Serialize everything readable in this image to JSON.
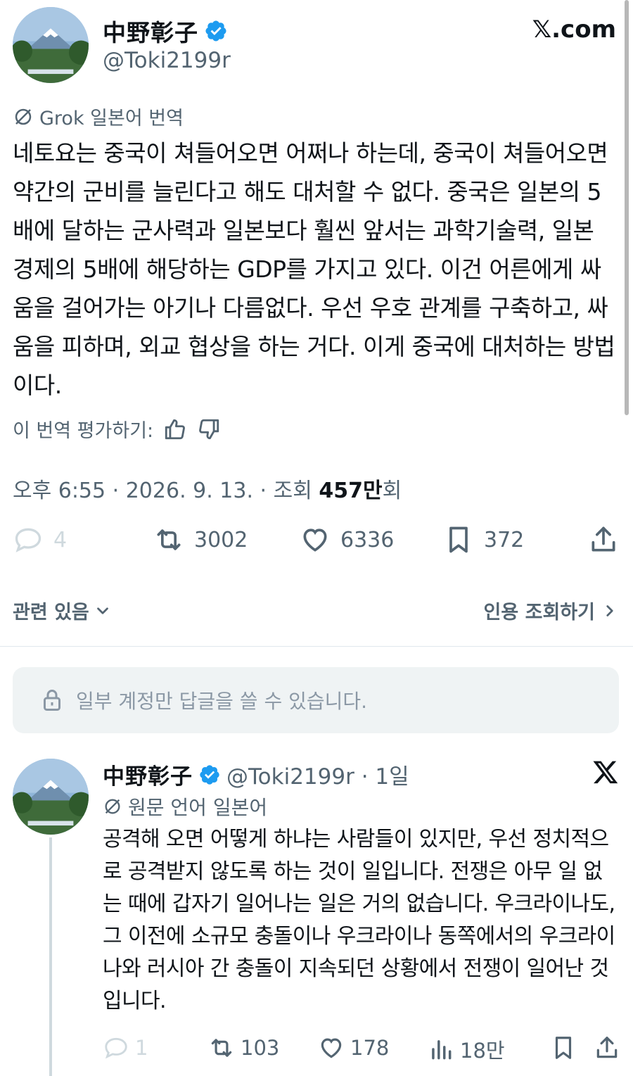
{
  "header": {
    "display_name": "中野彰子",
    "handle": "@Toki2199r",
    "site": "𝕏.com"
  },
  "grok": {
    "label": "Grok 일본어 번역"
  },
  "translation": {
    "text": "네토요는 중국이 쳐들어오면 어쩌나 하는데, 중국이 쳐들어오면 약간의 군비를 늘린다고 해도 대처할 수 없다. 중국은 일본의 5배에 달하는 군사력과 일본보다 훨씬 앞서는 과학기술력, 일본 경제의 5배에 해당하는 GDP를 가지고 있다. 이건 어른에게 싸움을 걸어가는 아기나 다름없다. 우선 우호 관계를 구축하고, 싸움을 피하며, 외교 협상을 하는 거다. 이게 중국에 대처하는 방법이다."
  },
  "rating": {
    "label": "이 번역 평가하기:"
  },
  "meta": {
    "time": "오후 6:55",
    "sep1": " · ",
    "date": "2026. 9. 13.",
    "sep2": " · ",
    "views_label": "조회 ",
    "views_value": "457만",
    "views_suffix": "회"
  },
  "actions": {
    "replies": "4",
    "reposts": "3002",
    "likes": "6336",
    "bookmarks": "372"
  },
  "related": {
    "label": "관련 있음",
    "quotes_label": "인용 조회하기"
  },
  "restricted": {
    "text": "일부 계정만 답글을 쓸 수 있습니다."
  },
  "reply": {
    "display_name": "中野彰子",
    "handle_time": "@Toki2199r · 1일",
    "orig_lang": "원문 언어 일본어",
    "text": "공격해 오면 어떻게 하냐는 사람들이 있지만, 우선 정치적으로 공격받지 않도록 하는 것이 일입니다. 전쟁은 아무 일 없는 때에 갑자기 일어나는 일은 거의 없습니다. 우크라이나도, 그 이전에 소규모 충돌이나 우크라이나 동쪽에서의 우크라이나와 러시아 간 충돌이 지속되던 상황에서 전쟁이 일어난 것입니다.",
    "replies": "1",
    "reposts": "103",
    "likes": "178",
    "views": "18만"
  },
  "colors": {
    "text": "#0f1419",
    "secondary": "#536471",
    "verified": "#1d9bf0",
    "restricted_bg": "#eff3f4"
  },
  "icons": [
    "verified-badge-icon",
    "grok-icon",
    "thumbs-up-icon",
    "thumbs-down-icon",
    "reply-icon",
    "repost-icon",
    "like-icon",
    "bookmark-icon",
    "share-icon",
    "chevron-down-icon",
    "chevron-right-icon",
    "lock-icon",
    "x-logo-icon",
    "views-icon"
  ]
}
